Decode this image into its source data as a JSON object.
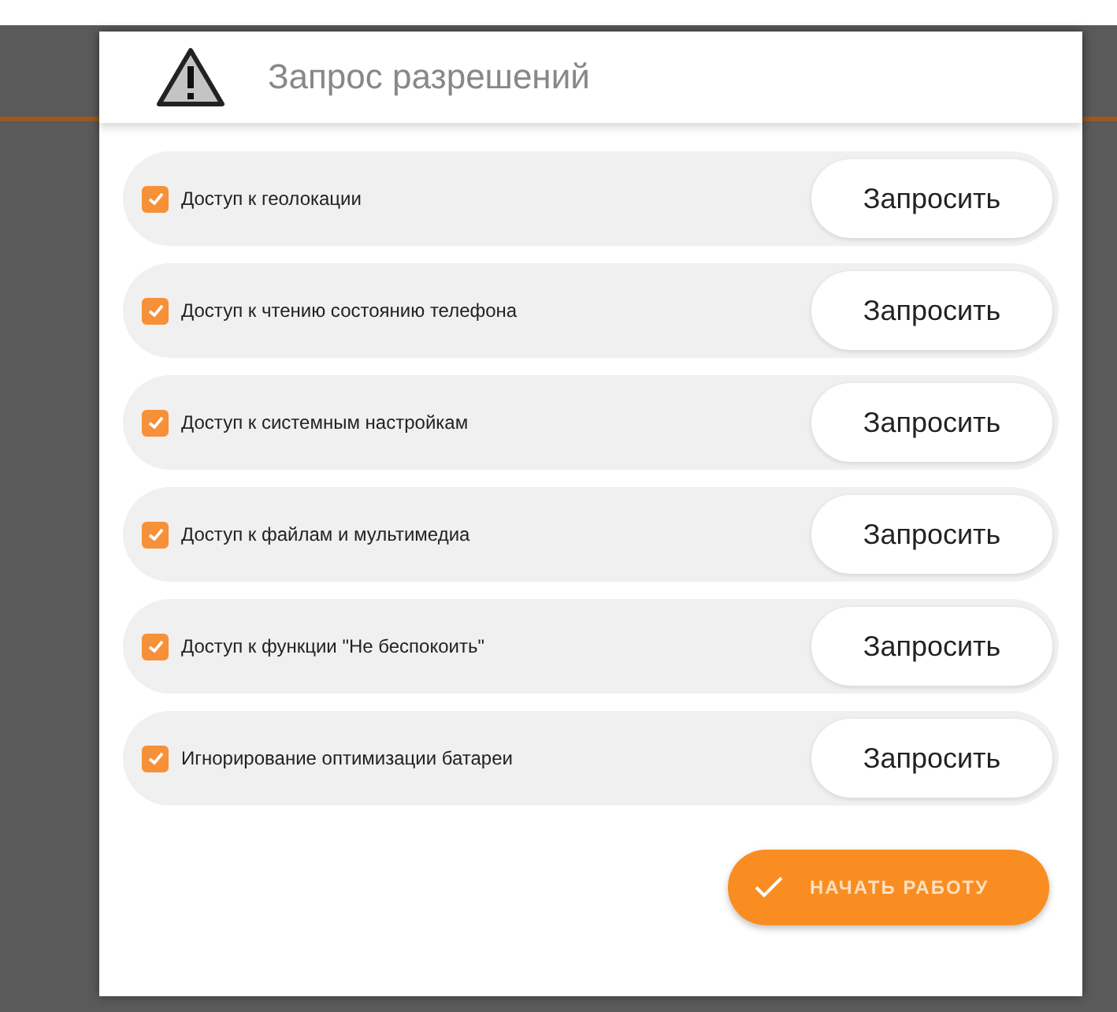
{
  "dialog": {
    "title": "Запрос разрешений"
  },
  "permissions": [
    {
      "label": "Доступ к геолокации",
      "checked": true,
      "button": "Запросить"
    },
    {
      "label": "Доступ к чтению состоянию телефона",
      "checked": true,
      "button": "Запросить"
    },
    {
      "label": "Доступ к системным настройкам",
      "checked": true,
      "button": "Запросить"
    },
    {
      "label": "Доступ к файлам и мультимедиа",
      "checked": true,
      "button": "Запросить"
    },
    {
      "label": "Доступ к функции \"Не беспокоить\"",
      "checked": true,
      "button": "Запросить"
    },
    {
      "label": "Игнорирование оптимизации батареи",
      "checked": true,
      "button": "Запросить"
    }
  ],
  "start_button": {
    "label": "НАЧАТЬ РАБОТУ"
  }
}
